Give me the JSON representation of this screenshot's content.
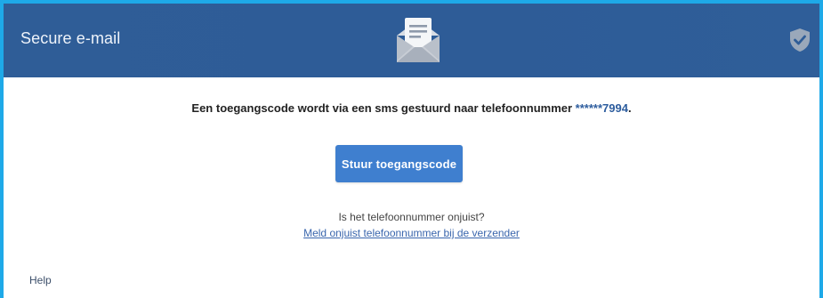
{
  "header": {
    "title": "Secure e-mail",
    "background_color": "#2f5d97",
    "icons": [
      "envelope-open-icon",
      "shield-check-icon"
    ]
  },
  "main": {
    "message_prefix": "Een toegangscode wordt via een sms gestuurd naar telefoonnummer ",
    "phone_masked": "******7994",
    "message_suffix": ".",
    "send_button_label": "Stuur toegangscode",
    "question": "Is het telefoonnummer onjuist?",
    "report_link": "Meld onjuist telefoonnummer bij de verzender"
  },
  "footer": {
    "help_label": "Help"
  },
  "colors": {
    "frame_border": "#1ea9e8",
    "button": "#3f7fcf",
    "link": "#3a66ad"
  }
}
